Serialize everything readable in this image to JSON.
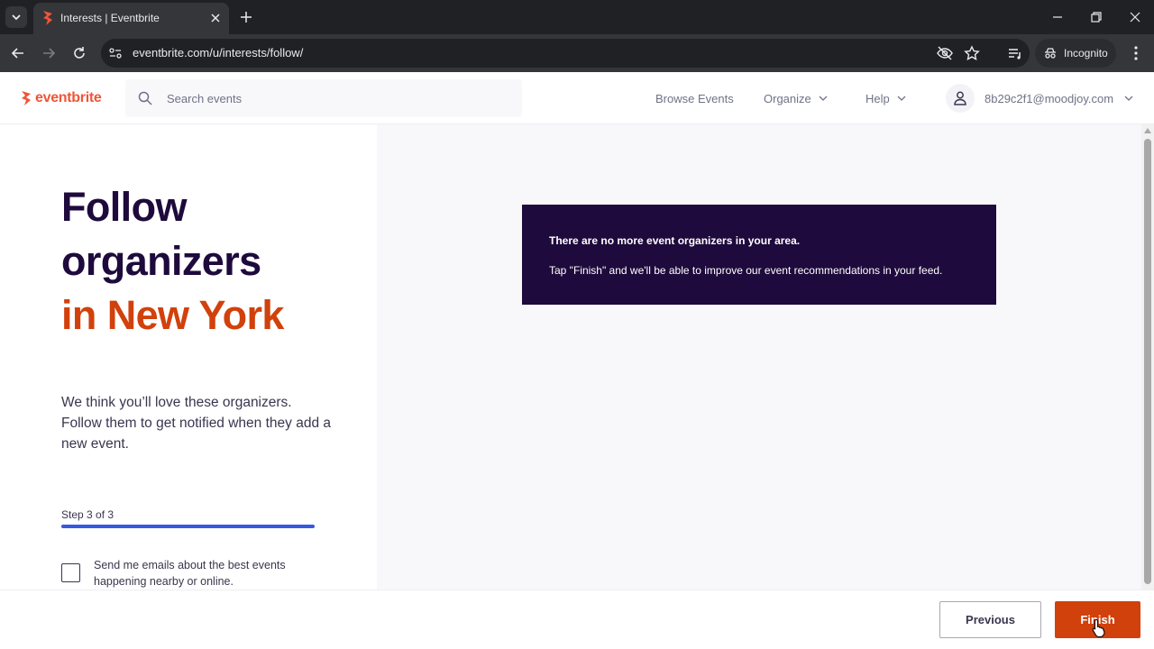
{
  "browser": {
    "tab_title": "Interests | Eventbrite",
    "url": "eventbrite.com/u/interests/follow/",
    "incognito_label": "Incognito"
  },
  "header": {
    "logo_text": "eventbrite",
    "search_placeholder": "Search events",
    "nav": {
      "browse": "Browse Events",
      "organize": "Organize",
      "help": "Help"
    },
    "user_email": "8b29c2f1@moodjoy.com"
  },
  "intro": {
    "heading_line1": "Follow",
    "heading_line2": "organizers",
    "heading_line3": "in New York",
    "description": "We think you’ll love these organizers. Follow them to get notified when they add a new event.",
    "step_label": "Step 3 of 3",
    "progress": {
      "current": 3,
      "total": 3
    },
    "email_optin_label": "Send me emails about the best events happening nearby or online.",
    "email_optin_checked": false
  },
  "notice": {
    "title": "There are no more event organizers in your area.",
    "body": "Tap \"Finish\" and we'll be able to improve our event recommendations in your feed."
  },
  "footer": {
    "previous_label": "Previous",
    "finish_label": "Finish"
  },
  "colors": {
    "brand_orange": "#f05537",
    "accent_red": "#d1410c",
    "navy": "#1e0a3c",
    "progress_blue": "#3659e3"
  }
}
